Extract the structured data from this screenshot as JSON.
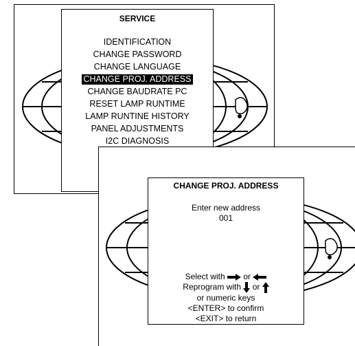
{
  "service_menu": {
    "title": "SERVICE",
    "items": [
      {
        "label": "IDENTIFICATION"
      },
      {
        "label": "CHANGE PASSWORD"
      },
      {
        "label": "CHANGE LANGUAGE"
      },
      {
        "label": "CHANGE PROJ. ADDRESS",
        "selected": true
      },
      {
        "label": "CHANGE BAUDRATE PC"
      },
      {
        "label": "RESET LAMP RUNTIME"
      },
      {
        "label": "LAMP RUNTINE HISTORY"
      },
      {
        "label": "PANEL ADJUSTMENTS"
      },
      {
        "label": "I2C DIAGNOSIS"
      }
    ]
  },
  "address_dialog": {
    "title": "CHANGE PROJ. ADDRESS",
    "prompt": "Enter new address",
    "value": "001",
    "select_prefix": "Select with",
    "or1": "or",
    "reprogram_prefix": "Reprogram with",
    "or2": "or",
    "numeric_keys": "or numeric keys",
    "enter_hint": "<ENTER> to confirm",
    "exit_hint": "<EXIT> to return"
  },
  "icons": [
    "globe-graphic",
    "arrow-right-icon",
    "arrow-left-icon",
    "arrow-down-icon",
    "arrow-up-icon"
  ]
}
